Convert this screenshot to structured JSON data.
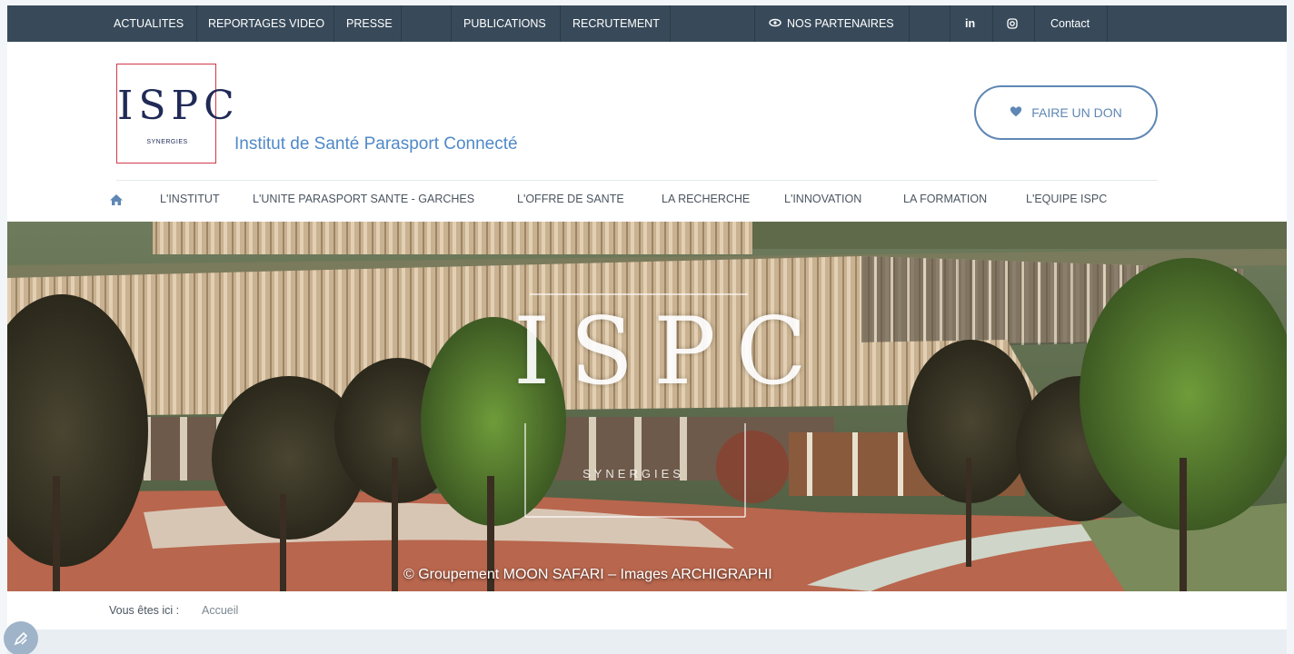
{
  "topbar": {
    "items": [
      {
        "label": "ACTUALITES"
      },
      {
        "label": "REPORTAGES VIDEO"
      },
      {
        "label": "PRESSE"
      },
      {
        "label": "PUBLICATIONS"
      },
      {
        "label": "RECRUTEMENT"
      },
      {
        "label": "NOS PARTENAIRES"
      },
      {
        "label": "in"
      },
      {
        "label": "Contact"
      }
    ]
  },
  "header": {
    "logo_text": "ISPC",
    "logo_sub": "SYNERGIES",
    "site_title": "Institut de Santé Parasport Connecté",
    "donate_label": "FAIRE UN DON"
  },
  "mainnav": {
    "items": [
      {
        "label": "L'INSTITUT"
      },
      {
        "label": "L'UNITE PARASPORT SANTE - GARCHES"
      },
      {
        "label": "L'OFFRE DE SANTE"
      },
      {
        "label": "LA RECHERCHE"
      },
      {
        "label": "L'INNOVATION"
      },
      {
        "label": "LA FORMATION"
      },
      {
        "label": "L'EQUIPE ISPC"
      }
    ]
  },
  "hero": {
    "logo_text": "ISPC",
    "logo_sub": "SYNERGIES",
    "credit": "© Groupement MOON SAFARI – Images ARCHIGRAPHI"
  },
  "breadcrumb": {
    "label": "Vous êtes ici :",
    "current": "Accueil"
  },
  "colors": {
    "topbar": "#384a5a",
    "accent": "#5f87b5",
    "title": "#5089c8",
    "logo_border": "#d1394b"
  }
}
